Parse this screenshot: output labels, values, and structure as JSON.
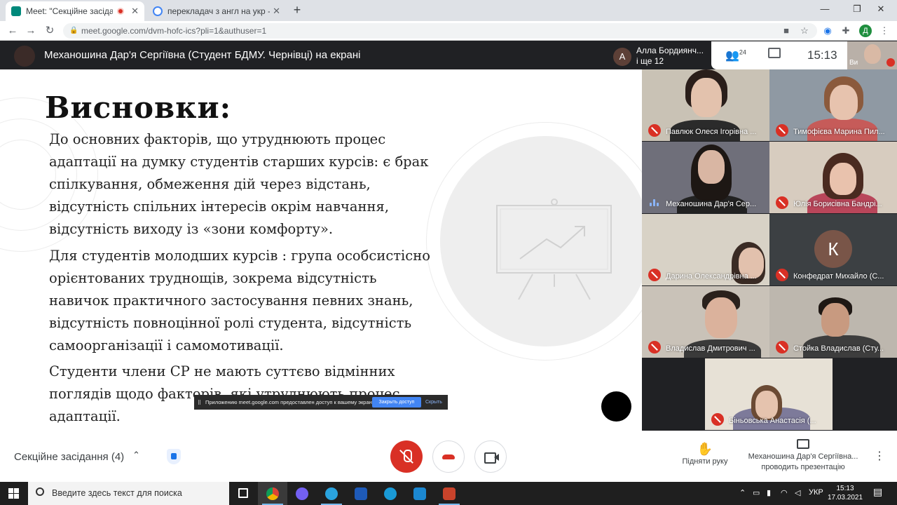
{
  "browser": {
    "tabs": [
      {
        "title": "Meet: \"Секційне засідання (",
        "active": true
      },
      {
        "title": "перекладач з англ на укр - Пои",
        "active": false
      }
    ],
    "url": "meet.google.com/dvm-hofc-ics?pli=1&authuser=1",
    "profile_initial": "Д"
  },
  "meet_top": {
    "presenting_title": "Механошина Дар'я Сергіївна (Студент БДМУ. Чернівці) на екрані",
    "speaker_initial": "А",
    "speaker_name": "Алла Бордиянч...",
    "speaker_more": "і ще 12",
    "people_count": "24",
    "time": "15:13",
    "self_label": "Ви"
  },
  "slide": {
    "title": "Висновки:",
    "paragraphs": [
      [
        "До основних факторів, що утруднюють процес",
        "адаптації на думку студентів старших курсів: є брак",
        "спілкування, обмеження дій через відстань,",
        "відсутність спільних інтересів окрім навчання,",
        "відсутність виходу із «зони комфорту»."
      ],
      [
        "Для студентів молодших курсів : група особсистісно",
        "орієнтованих труднощів, зокрема відсутність",
        "навичок практичного застосування певних знань,",
        "відсутність повноцінної ролі студента, відсутність",
        "самоорганізації і самомотивації."
      ],
      [
        "Студенти члени СР не мають суттєво відмінних",
        "поглядів щодо факторів, які утруднюють процес",
        "адаптації."
      ]
    ]
  },
  "share_banner": {
    "text": "Приложению meet.google.com предоставлен доступ к вашему экрану.",
    "stop_label": "Закрыть доступ",
    "hide_label": "Скрыть"
  },
  "participants": [
    {
      "name": "Павлюк Олеся Ігорівна ..."
    },
    {
      "name": "Тимофієва Марина Пил..."
    },
    {
      "name": "Механошина Дар'я Сер..."
    },
    {
      "name": "Юлія Борисівна Бандрі..."
    },
    {
      "name": "Дарина Олександрівна ..."
    },
    {
      "name": "Конфедрат Михайло (С...",
      "initial": "К"
    },
    {
      "name": "Владислав Дмитрович ..."
    },
    {
      "name": "Стойка Владислав (Сту..."
    },
    {
      "name": "Біньовська Анастасія (..."
    }
  ],
  "bottom_bar": {
    "meeting_name": "Секційне засідання (4)",
    "raise_hand": "Підняти руку",
    "presenting_line1": "Механошина Дар'я Сергіївна...",
    "presenting_line2": "проводить презентацію"
  },
  "taskbar": {
    "search_placeholder": "Введите здесь текст для поиска",
    "language": "УКР",
    "time": "15:13",
    "date": "17.03.2021"
  },
  "colors": {
    "meet_dark": "#202124",
    "mute_red": "#d93025",
    "accent_blue": "#1a73e8"
  }
}
